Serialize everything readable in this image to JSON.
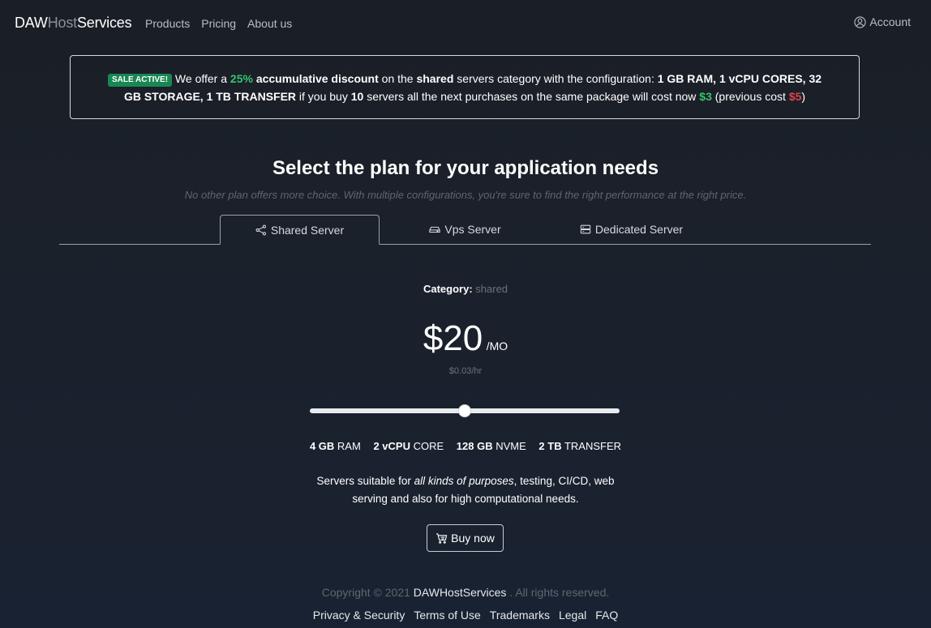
{
  "nav": {
    "brand_part1": "DAW",
    "brand_part2": "Host",
    "brand_part3": "Services",
    "links": [
      "Products",
      "Pricing",
      "About us"
    ],
    "account_label": "Account"
  },
  "sale": {
    "badge": "SALE ACTIVE!",
    "t1": " We offer a ",
    "discount": "25%",
    "t2": " ",
    "accumulative": "accumulative discount",
    "t3": " on the ",
    "shared": "shared",
    "t4": " servers category with the configuration: ",
    "config": "1 GB RAM, 1 vCPU CORES, 32 GB STORAGE, 1 TB TRANSFER",
    "t5": " if you buy ",
    "count": "10",
    "t6": " servers all the next purchases on the same package will cost now ",
    "new_price": "$3",
    "t7": " (previous cost ",
    "old_price": "$5",
    "t8": ")"
  },
  "headline": "Select the plan for your application needs",
  "subline": "No other plan offers more choice. With multiple configurations, you're sure to find the right performance at the right price.",
  "tabs": [
    {
      "label": "Shared Server",
      "icon": "share-icon",
      "active": true
    },
    {
      "label": "Vps Server",
      "icon": "hdd-icon",
      "active": false
    },
    {
      "label": "Dedicated Server",
      "icon": "server-icon",
      "active": false
    }
  ],
  "plan": {
    "category_label": "Category:",
    "category_value": "shared",
    "price": "$20",
    "price_unit": "/MO",
    "hourly": "$0.03/hr",
    "slider_level": 0.5,
    "specs": [
      {
        "value": "4 GB",
        "unit": "RAM"
      },
      {
        "value": "2 vCPU",
        "unit": "CORE"
      },
      {
        "value": "128 GB",
        "unit": "NVME"
      },
      {
        "value": "2 TB",
        "unit": "TRANSFER"
      }
    ],
    "desc_1": "Servers suitable for ",
    "desc_em": "all kinds of purposes",
    "desc_2": ", testing, CI/CD, web serving and also for high computational needs.",
    "buy_label": "Buy now"
  },
  "footer": {
    "copyright_1": "Copyright © 2021 ",
    "copyright_brand": "DAWHostServices",
    "copyright_2": " . All rights reserved.",
    "links": [
      "Privacy & Security",
      "Terms of Use",
      "Trademarks",
      "Legal",
      "FAQ"
    ]
  },
  "colors": {
    "accent_green": "#198754",
    "discount_green": "#34c46b",
    "old_price_red": "#e0434f"
  }
}
